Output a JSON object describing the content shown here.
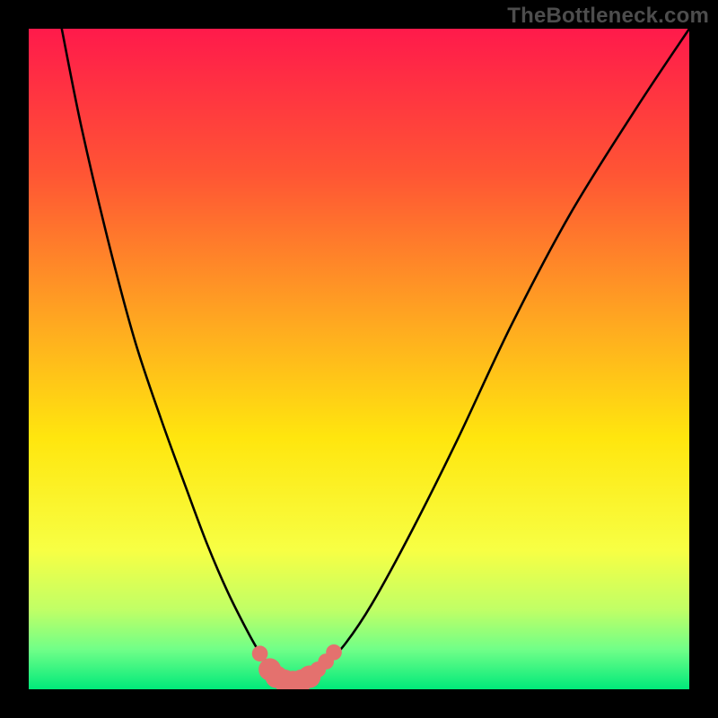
{
  "watermark": "TheBottleneck.com",
  "chart_data": {
    "type": "line",
    "title": "",
    "xlabel": "",
    "ylabel": "",
    "xlim": [
      0,
      100
    ],
    "ylim": [
      0,
      100
    ],
    "grid": false,
    "legend": false,
    "gradient_stops": [
      {
        "offset": 0.0,
        "color": "#ff1a4b"
      },
      {
        "offset": 0.22,
        "color": "#ff5534"
      },
      {
        "offset": 0.45,
        "color": "#ffaa20"
      },
      {
        "offset": 0.62,
        "color": "#ffe60e"
      },
      {
        "offset": 0.79,
        "color": "#f7ff44"
      },
      {
        "offset": 0.88,
        "color": "#c0ff66"
      },
      {
        "offset": 0.94,
        "color": "#70ff88"
      },
      {
        "offset": 1.0,
        "color": "#00e97a"
      }
    ],
    "series": [
      {
        "name": "curve",
        "color": "#000000",
        "x": [
          5,
          8,
          12,
          16,
          20,
          24,
          27,
          30,
          33,
          35,
          37,
          38.5,
          40,
          41.5,
          45,
          48,
          52,
          58,
          65,
          73,
          82,
          92,
          100
        ],
        "y": [
          100,
          85,
          68,
          53,
          41,
          30,
          22,
          15,
          9,
          5.5,
          3,
          1.8,
          1.2,
          1.8,
          3.8,
          7,
          13,
          24,
          38,
          55,
          72,
          88,
          100
        ]
      }
    ],
    "markers": {
      "color": "#e4716e",
      "radius_small": 1.2,
      "points_small": [
        {
          "x": 35.0,
          "y": 5.4
        },
        {
          "x": 43.8,
          "y": 3.0
        },
        {
          "x": 45.0,
          "y": 4.2
        },
        {
          "x": 46.2,
          "y": 5.6
        }
      ],
      "radius_big": 1.7,
      "points_big": [
        {
          "x": 36.5,
          "y": 3.0
        },
        {
          "x": 37.5,
          "y": 1.9
        },
        {
          "x": 38.7,
          "y": 1.3
        },
        {
          "x": 40.0,
          "y": 1.1
        },
        {
          "x": 41.3,
          "y": 1.3
        },
        {
          "x": 42.5,
          "y": 1.9
        }
      ]
    }
  }
}
